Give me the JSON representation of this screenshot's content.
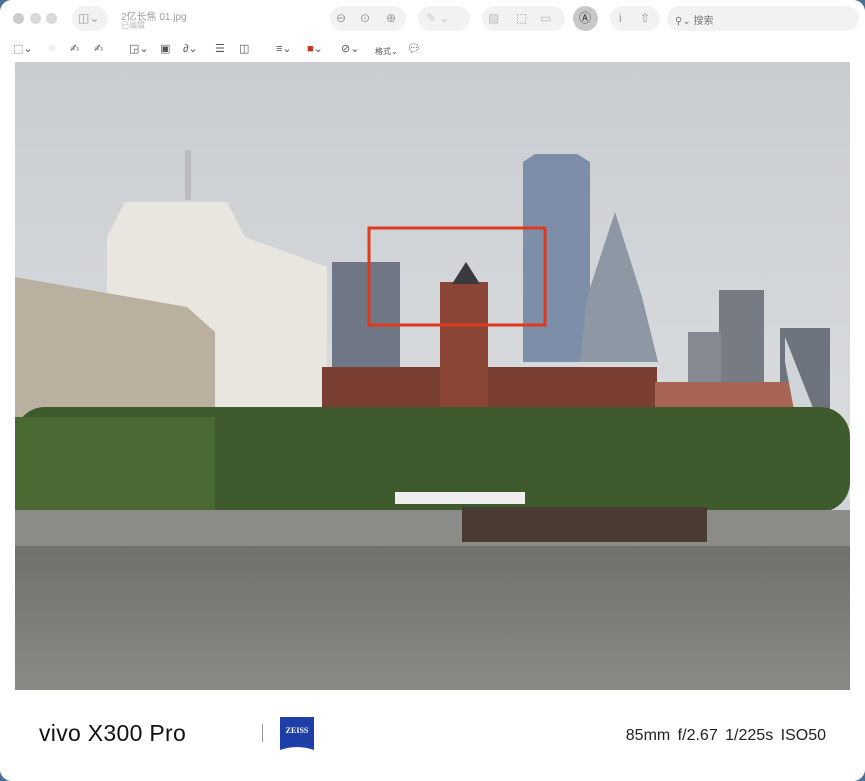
{
  "window": {
    "title": "2亿长焦 01.jpg",
    "subtitle": "已编辑",
    "search_placeholder": "搜索"
  },
  "toolbar": {
    "icons": [
      "sidebar-icon",
      "zoom-out-icon",
      "actual-size-icon",
      "zoom-in-icon",
      "pen-icon",
      "crop-icon",
      "rotate-icon",
      "signature-icon",
      "markup-icon",
      "info-icon",
      "share-icon",
      "search-icon"
    ]
  },
  "markup_toolbar": {
    "format_label": "格式",
    "border_color": "#c8321e"
  },
  "footer": {
    "brand": "vivo X300 Pro",
    "logo_text": "ZEISS",
    "exif": "85mm  f/2.67  1/225s  ISO50"
  },
  "annotation": {
    "color": "#e03a1e"
  }
}
